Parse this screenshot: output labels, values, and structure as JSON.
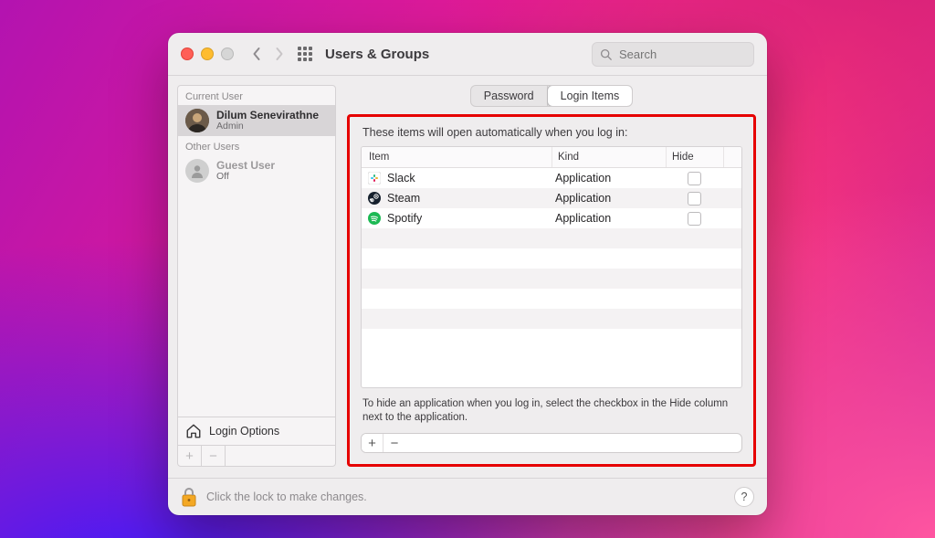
{
  "toolbar": {
    "title": "Users & Groups",
    "search_placeholder": "Search"
  },
  "sidebar": {
    "sections": [
      {
        "label": "Current User",
        "items": [
          {
            "name": "Dilum Senevirathne",
            "role": "Admin",
            "selected": true,
            "avatar": "user"
          }
        ]
      },
      {
        "label": "Other Users",
        "items": [
          {
            "name": "Guest User",
            "role": "Off",
            "selected": false,
            "avatar": "guest"
          }
        ]
      }
    ],
    "login_options_label": "Login Options"
  },
  "tabs": {
    "items": [
      {
        "label": "Password",
        "active": false
      },
      {
        "label": "Login Items",
        "active": true
      }
    ]
  },
  "login_items": {
    "description": "These items will open automatically when you log in:",
    "columns": {
      "item": "Item",
      "kind": "Kind",
      "hide": "Hide"
    },
    "rows": [
      {
        "name": "Slack",
        "kind": "Application",
        "hide": false,
        "icon": "slack"
      },
      {
        "name": "Steam",
        "kind": "Application",
        "hide": false,
        "icon": "steam"
      },
      {
        "name": "Spotify",
        "kind": "Application",
        "hide": false,
        "icon": "spotify"
      }
    ],
    "hint": "To hide an application when you log in, select the checkbox in the Hide column next to the application."
  },
  "footer": {
    "lock_text": "Click the lock to make changes."
  },
  "icons": {
    "slack_bg": "#ffffff",
    "slack_border": "#e0e0e0",
    "steam_bg": "#16202d",
    "spotify_bg": "#1db954"
  }
}
